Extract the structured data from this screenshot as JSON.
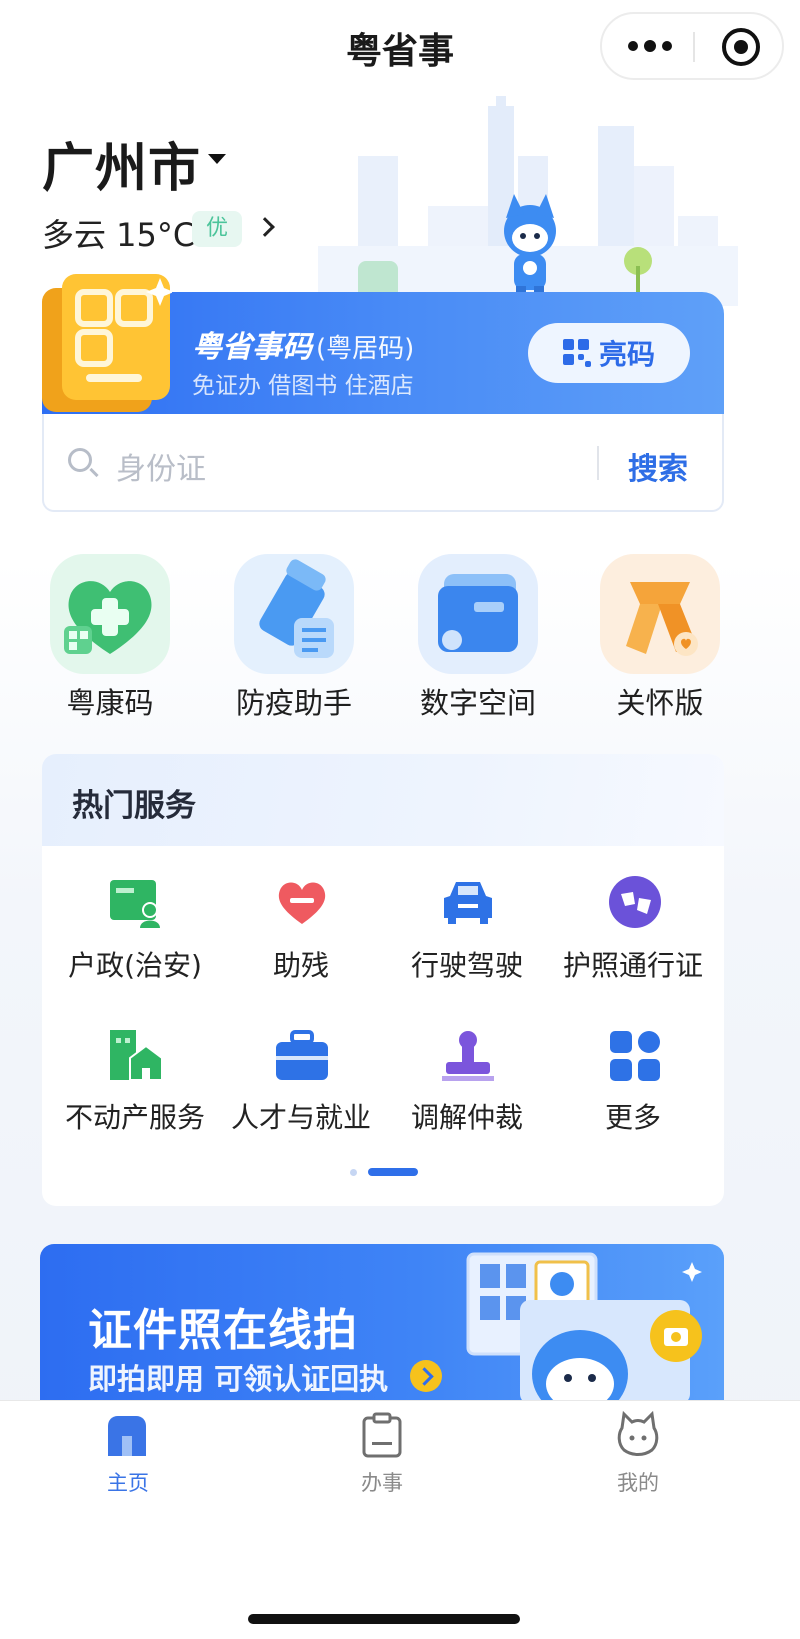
{
  "header": {
    "title": "粤省事",
    "menu_icon": "more-dots-icon",
    "close_icon": "target-close-icon"
  },
  "location": {
    "city": "广州市",
    "weather": "多云 15°C",
    "aqi": "优"
  },
  "code_card": {
    "title": "粤省事码",
    "title_sub": "(粤居码)",
    "subtitle": "免证办 借图书 住酒店",
    "show_button": "亮码"
  },
  "search": {
    "placeholder": "身份证",
    "button": "搜索"
  },
  "quick_apps": [
    {
      "label": "粤康码",
      "icon": "health-heart-icon"
    },
    {
      "label": "防疫助手",
      "icon": "epidemic-helper-icon"
    },
    {
      "label": "数字空间",
      "icon": "digital-space-icon"
    },
    {
      "label": "关怀版",
      "icon": "care-scarf-icon"
    }
  ],
  "hot_services": {
    "title": "热门服务",
    "items": [
      {
        "label": "户政(治安)",
        "icon": "household-card-icon"
      },
      {
        "label": "助残",
        "icon": "heart-icon"
      },
      {
        "label": "行驶驾驶",
        "icon": "car-icon"
      },
      {
        "label": "护照通行证",
        "icon": "passport-globe-icon"
      },
      {
        "label": "不动产服务",
        "icon": "property-house-icon"
      },
      {
        "label": "人才与就业",
        "icon": "briefcase-icon"
      },
      {
        "label": "调解仲裁",
        "icon": "stamp-icon"
      },
      {
        "label": "更多",
        "icon": "grid-more-icon"
      }
    ],
    "page_index": 2,
    "page_count": 2
  },
  "banner": {
    "title": "证件照在线拍",
    "subtitle": "即拍即用 可领认证回执"
  },
  "tabbar": {
    "items": [
      {
        "label": "主页",
        "icon": "home-icon",
        "active": true
      },
      {
        "label": "办事",
        "icon": "clipboard-icon",
        "active": false
      },
      {
        "label": "我的",
        "icon": "mascot-face-icon",
        "active": false
      }
    ]
  },
  "colors": {
    "accent": "#2e6ee6",
    "aqi_good": "#4bc49a",
    "tab_active": "#3a74e6",
    "tab_inactive": "#8a8a8a"
  }
}
